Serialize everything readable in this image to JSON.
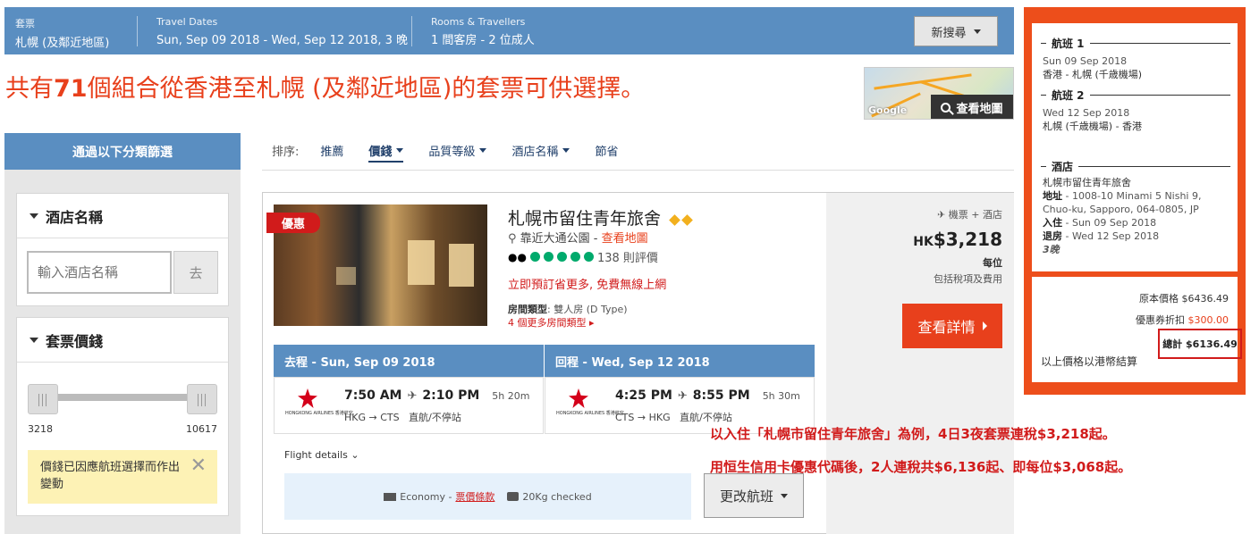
{
  "header": {
    "packages_label": "套票",
    "destination": "札幌 (及鄰近地區)",
    "dates_label": "Travel Dates",
    "dates_value": "Sun, Sep 09 2018 - Wed, Sep 12 2018, 3 晚",
    "rooms_label": "Rooms & Travellers",
    "rooms_value": "1 間客房 - 2 位成人",
    "new_search": "新搜尋"
  },
  "headline": {
    "prefix": "共有",
    "count": "71",
    "suffix": "個組合從香港至札幌 (及鄰近地區)的套票可供選擇。"
  },
  "map": {
    "google": "Google",
    "view_map": "查看地圖"
  },
  "sidebar": {
    "filter_title": "通過以下分類篩選",
    "hotel_name_title": "酒店名稱",
    "hotel_name_placeholder": "輸入酒店名稱",
    "go": "去",
    "price_title": "套票價錢",
    "price_min": "3218",
    "price_max": "10617",
    "price_note": "價錢已因應航班選擇而作出變動"
  },
  "sort": {
    "label": "排序:",
    "items": [
      "推薦",
      "價錢",
      "品質等級",
      "酒店名稱",
      "節省"
    ]
  },
  "result": {
    "deal_badge": "優惠",
    "hotel_name": "札幌市留住青年旅舍",
    "location_prefix": "靠近大通公園 - ",
    "view_map": "查看地圖",
    "reviews": "138 則評價",
    "promo": "立即預訂省更多, 免費無線上網",
    "room_label": "房間類型",
    "room_value": ": 雙人房 (D Type)",
    "more_rooms": "4 個更多房間類型",
    "package_tag": "機票 + 酒店",
    "price_currency": "HK",
    "price_amount": "$3,218",
    "per_person": "每位",
    "tax_note": "包括稅項及費用",
    "details_button": "查看詳情",
    "outbound_title": "去程 - Sun, Sep 09 2018",
    "return_title": "回程 - Wed, Sep 12 2018",
    "airline_text": "HONGKONG AIRLINES 香港航空",
    "outbound": {
      "depart": "7:50 AM",
      "arrive": "2:10 PM",
      "duration": "5h 20m",
      "route": "HKG → CTS",
      "stops": "直航/不停站"
    },
    "inbound": {
      "depart": "4:25 PM",
      "arrive": "8:55 PM",
      "duration": "5h 30m",
      "route": "CTS → HKG",
      "stops": "直航/不停站"
    },
    "flight_details": "Flight details",
    "economy": "Economy - ",
    "fare_rules": "票價條款",
    "baggage": "20Kg checked",
    "change_flight": "更改航班"
  },
  "annotations": {
    "line1": "以入住「札幌市留住青年旅舍」為例，4日3夜套票連稅$3,218起。",
    "line2": "用恒生信用卡優惠代碼後，2人連稅共$6,136起、即每位$3,068起。"
  },
  "summary": {
    "flight1_title": "航班 1",
    "flight1_date": "Sun 09 Sep 2018",
    "flight1_route": "香港 - 札幌 (千歳機場)",
    "flight2_title": "航班 2",
    "flight2_date": "Wed 12 Sep 2018",
    "flight2_route": "札幌 (千歳機場) - 香港",
    "hotel_title": "酒店",
    "hotel_name": "札幌市留住青年旅舍",
    "address_label": "地址",
    "address_value": " - 1008-10 Minami 5 Nishi 9, Chuo-ku, Sapporo, 064-0805, JP",
    "checkin_label": "入住",
    "checkin_value": " - Sun 09 Sep 2018",
    "checkout_label": "退房",
    "checkout_value": " - Wed 12 Sep 2018",
    "nights": "3晚",
    "original_label": "原本價格",
    "original_value": "$6436.49",
    "coupon_label": "優惠券折扣",
    "coupon_value": "$300.00",
    "total_label": "總計",
    "total_value": "$6136.49",
    "currency_note": "以上價格以港幣結算"
  },
  "colors": {
    "header_blue": "#5a8ec1",
    "accent_orange": "#e8401c",
    "summary_orange": "#ed4e1b",
    "note_yellow": "#fdf2b5"
  }
}
